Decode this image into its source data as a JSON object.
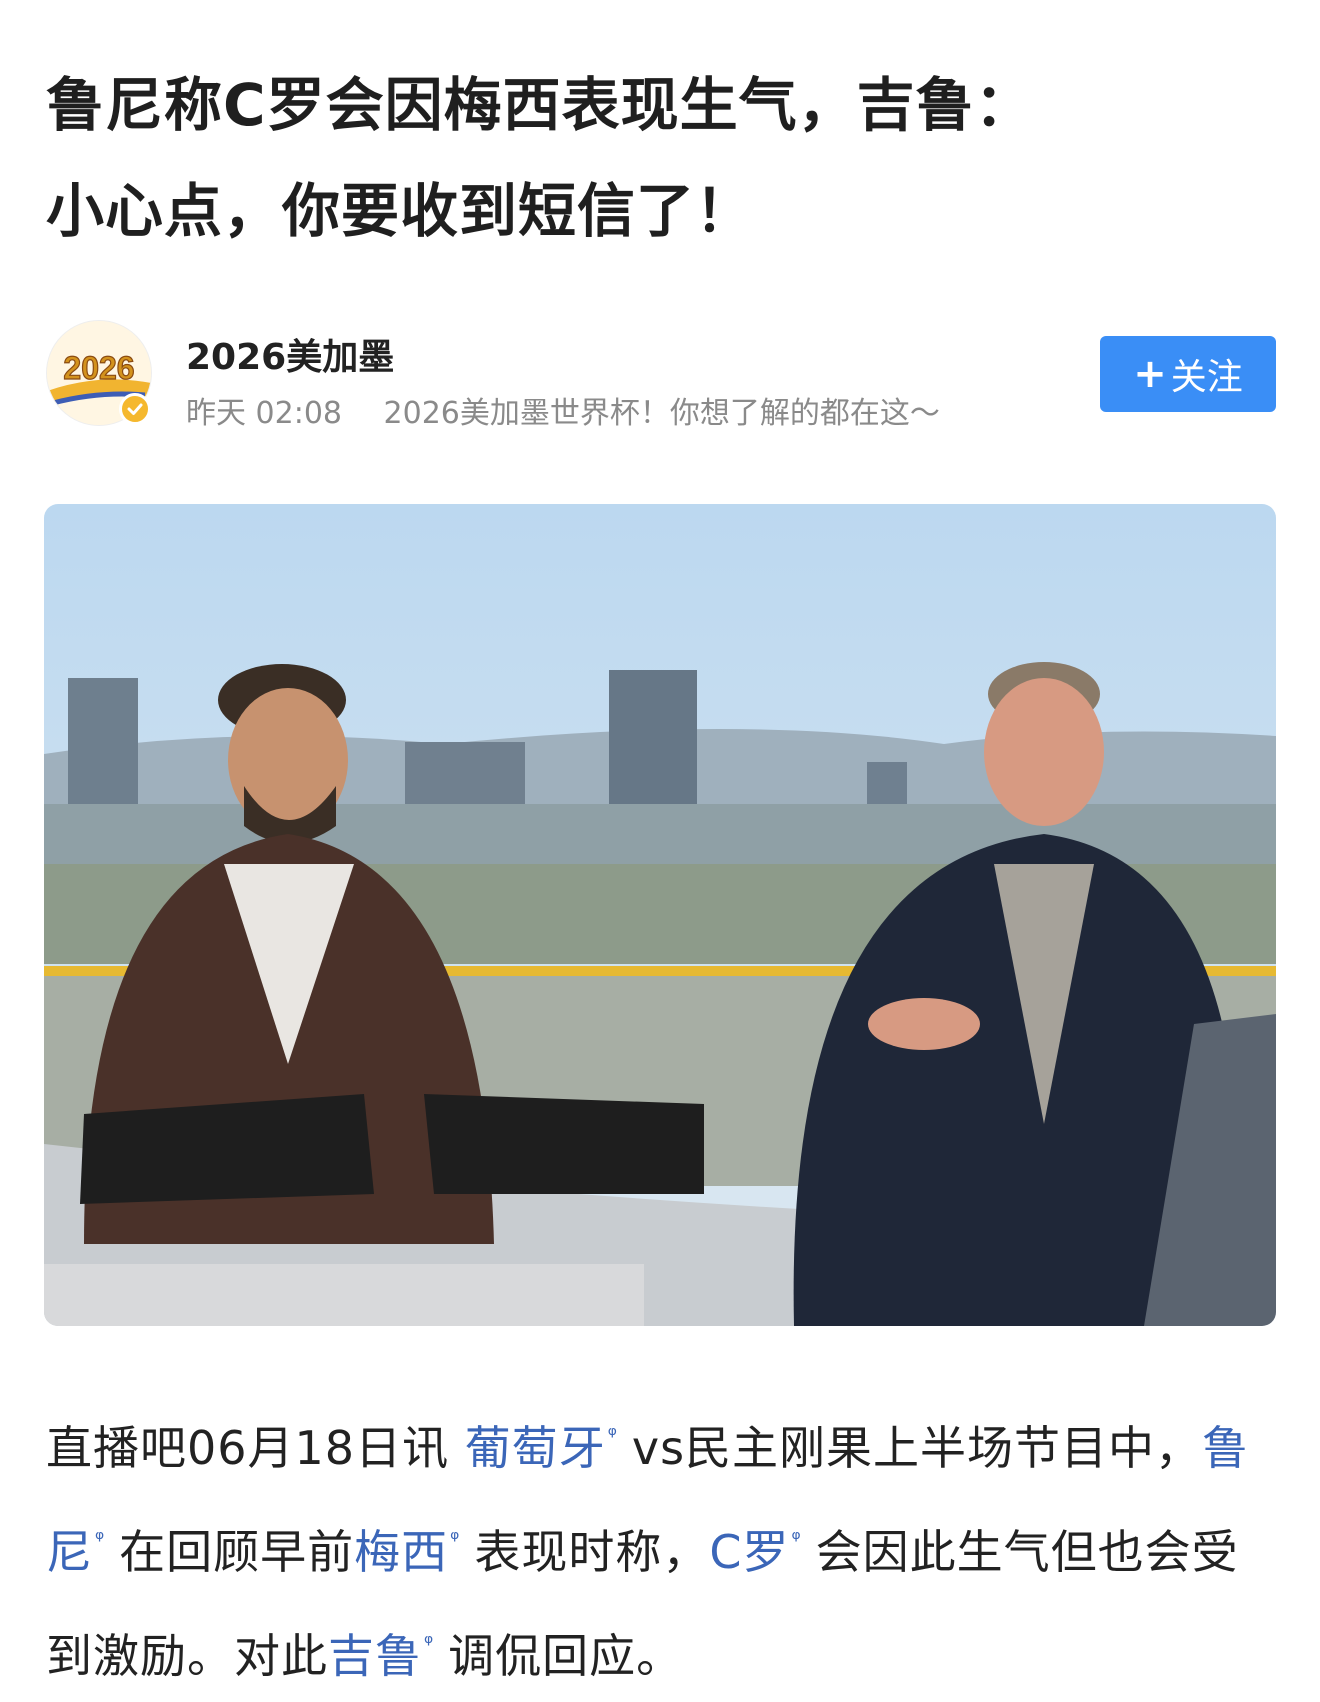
{
  "article": {
    "title_line1": "鲁尼称C罗会因梅西表现生气，吉鲁：",
    "title_line2": "小心点，你要收到短信了！"
  },
  "author": {
    "avatar_text": "2026",
    "name": "2026美加墨",
    "time": "昨天 02:08",
    "description": "2026美加墨世界杯！你想了解的都在这～",
    "follow_label": "关注",
    "follow_plus": "+",
    "verified_color": "#f5b82e"
  },
  "follow_color": "#3a8ef6",
  "link_color": "#3b66b8",
  "body": {
    "p1_lead": "直播吧06月18日讯 ",
    "link_portugal": "葡萄牙",
    "p1_mid1": "vs民主刚果上半场节目中，",
    "link_rooney": "鲁尼",
    "p1_mid2": "在回顾早前",
    "link_messi": "梅西",
    "p1_mid3": "表现时称，",
    "link_cr": "C罗",
    "p1_mid4": "会因此生气但也会受到激励。对此",
    "link_giroud": "吉鲁",
    "p1_end": "调侃回应。",
    "search_mark": "ᵠ"
  }
}
